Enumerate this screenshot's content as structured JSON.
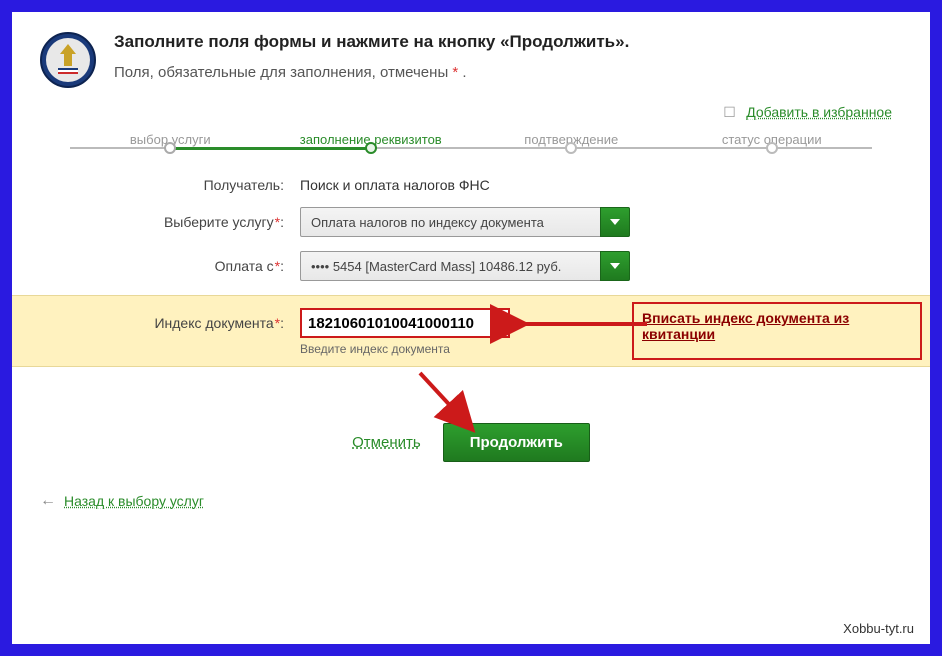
{
  "header": {
    "title": "Заполните поля формы и нажмите на кнопку «Продолжить».",
    "subtitle_pre": "Поля, обязательные для заполнения, отмечены ",
    "subtitle_mark": "*",
    "subtitle_post": " ."
  },
  "favorite": {
    "label": "Добавить в избранное"
  },
  "steps": [
    {
      "label": "выбор услуги"
    },
    {
      "label": "заполнение реквизитов"
    },
    {
      "label": "подтверждение"
    },
    {
      "label": "статус операции"
    }
  ],
  "form": {
    "recipient_label": "Получатель:",
    "recipient_value": "Поиск и оплата налогов ФНС",
    "service_label": "Выберите услугу",
    "service_value": "Оплата налогов по индексу документа",
    "payfrom_label": "Оплата с",
    "payfrom_value": "•••• 5454 [MasterCard Mass] 10486.12 руб.",
    "docindex_label": "Индекс документа",
    "docindex_value": "18210601010041000110",
    "docindex_hint": "Введите индекс документа",
    "star": "*",
    "colon": ":"
  },
  "callout": {
    "text": "Вписать индекс документа из квитанции"
  },
  "actions": {
    "cancel": "Отменить",
    "continue": "Продолжить"
  },
  "back": {
    "label": "Назад к выбору услуг"
  },
  "watermark": "Xobbu-tyt.ru",
  "colors": {
    "green": "#2a8c2a",
    "red": "#cc1a1a",
    "highlight": "#fff2bf"
  }
}
